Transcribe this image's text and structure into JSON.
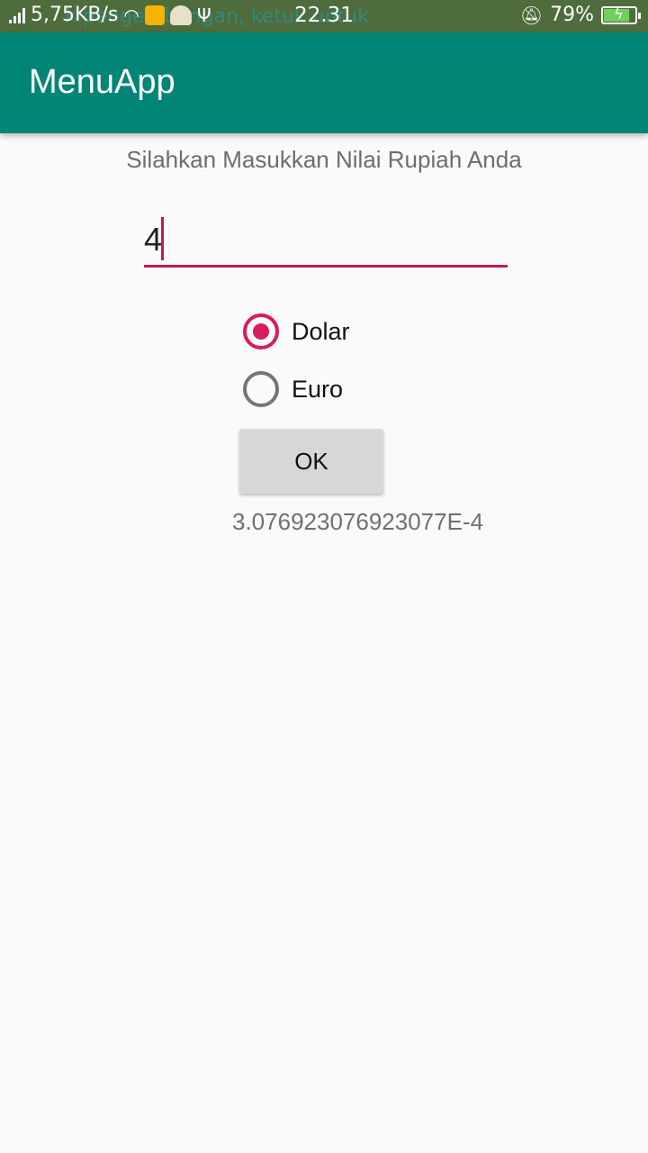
{
  "status_bar": {
    "speed": "5,75KB/s",
    "time": "22.31",
    "battery": "79%",
    "ticker": "k pengembangan, ketuk untuk"
  },
  "app_bar": {
    "title": "MenuApp"
  },
  "form": {
    "prompt": "Silahkan Masukkan Nilai Rupiah Anda",
    "input_value": "4",
    "options": [
      {
        "label": "Dolar",
        "checked": true
      },
      {
        "label": "Euro",
        "checked": false
      }
    ],
    "ok_label": "OK",
    "result": "3.076923076923077E-4"
  },
  "colors": {
    "app_bar": "#008577",
    "accent": "#d81b60",
    "status_bar": "#4e6c3c"
  }
}
